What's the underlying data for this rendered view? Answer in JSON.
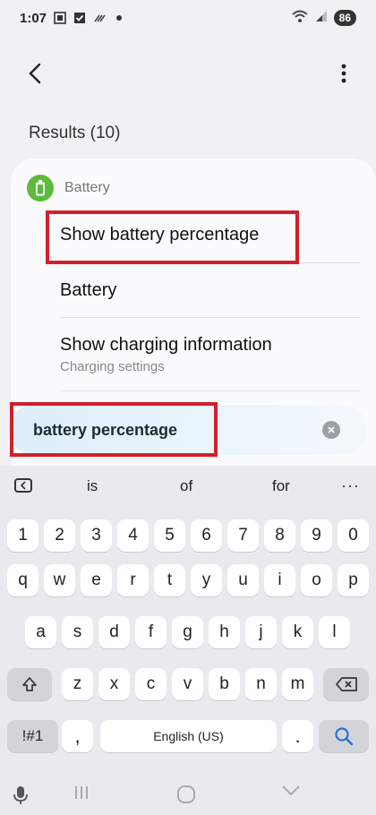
{
  "status_bar": {
    "time": "1:07",
    "battery": "86"
  },
  "results": {
    "title": "Results (10)",
    "category": "Battery",
    "items": [
      {
        "title": "Show battery percentage",
        "subtitle": ""
      },
      {
        "title": "Battery",
        "subtitle": ""
      },
      {
        "title": "Show charging information",
        "subtitle": "Charging settings"
      }
    ]
  },
  "search": {
    "value": "battery percentage"
  },
  "keyboard": {
    "suggestions": [
      "is",
      "of",
      "for"
    ],
    "more": "···",
    "number_row": [
      "1",
      "2",
      "3",
      "4",
      "5",
      "6",
      "7",
      "8",
      "9",
      "0"
    ],
    "row1": [
      "q",
      "w",
      "e",
      "r",
      "t",
      "y",
      "u",
      "i",
      "o",
      "p"
    ],
    "row2": [
      "a",
      "s",
      "d",
      "f",
      "g",
      "h",
      "j",
      "k",
      "l"
    ],
    "row3": [
      "z",
      "x",
      "c",
      "v",
      "b",
      "n",
      "m"
    ],
    "symbols_key": "!#1",
    "comma_key": ",",
    "space_label": "English (US)",
    "period_key": "."
  },
  "colors": {
    "highlight": "#d21f2b",
    "battery_icon": "#5dbb3b",
    "search_key_icon": "#2b6fd6"
  },
  "icons": {
    "back": "back-arrow-icon",
    "more": "more-vert-icon",
    "clear": "clear-icon",
    "shift": "shift-icon",
    "backspace": "backspace-icon",
    "search": "search-icon",
    "mic": "mic-icon",
    "recents": "recents-icon",
    "home": "home-icon",
    "back_nav": "nav-back-icon"
  }
}
